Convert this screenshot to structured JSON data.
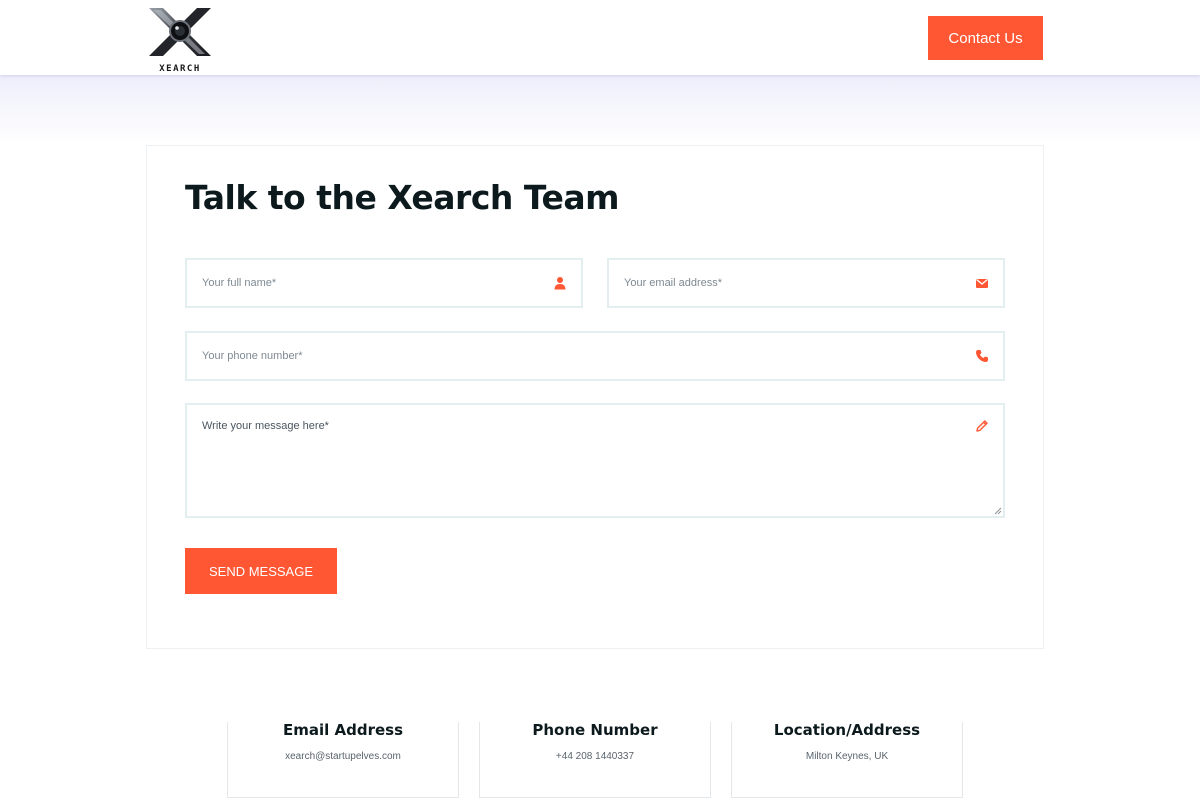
{
  "brand": {
    "logo_text": "XEARCH",
    "accent_color": "#ff5733"
  },
  "header": {
    "contact_label": "Contact Us"
  },
  "form": {
    "title": "Talk to the Xearch Team",
    "name_placeholder": "Your full name*",
    "name_icon": "user-icon",
    "email_placeholder": "Your email address*",
    "email_icon": "envelope-icon",
    "phone_placeholder": "Your phone number*",
    "phone_icon": "phone-icon",
    "message_placeholder": "Write your message here*",
    "message_icon": "pencil-icon",
    "submit_label": "SEND MESSAGE"
  },
  "info": {
    "email": {
      "title": "Email Address",
      "value": "xearch@startupelves.com"
    },
    "phone": {
      "title": "Phone Number",
      "value": "+44 208 1440337"
    },
    "location": {
      "title": "Location/Address",
      "value": "Milton Keynes, UK"
    }
  }
}
